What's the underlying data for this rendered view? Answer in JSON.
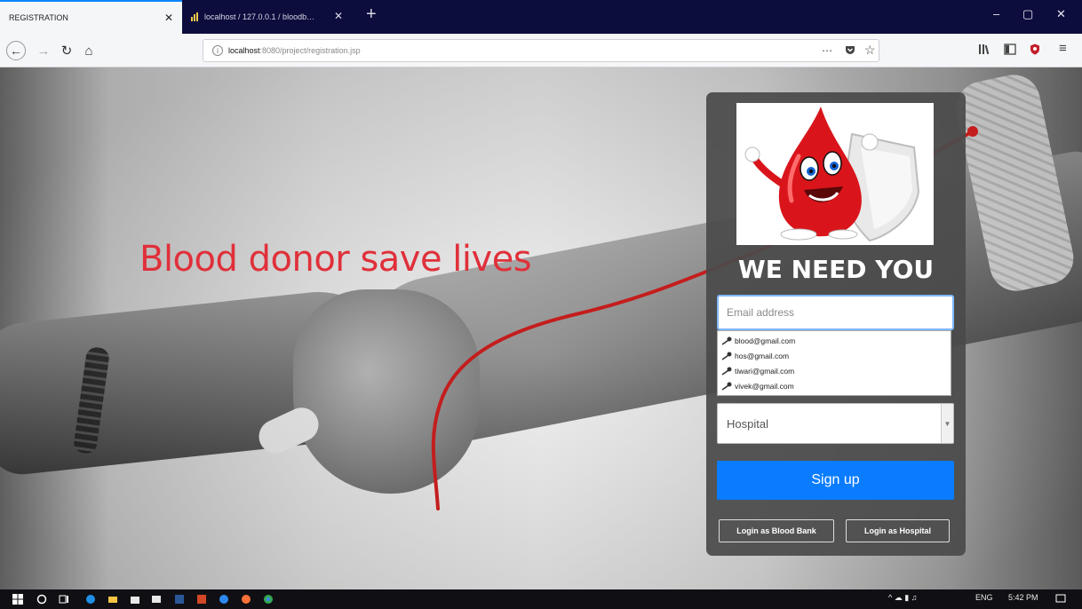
{
  "browser": {
    "tabs": [
      {
        "title": "REGISTRATION",
        "active": true
      },
      {
        "title": "localhost / 127.0.0.1 / bloodb…",
        "active": false
      }
    ],
    "new_tab_symbol": "+",
    "window_controls": {
      "minimize": "–",
      "maximize": "▢",
      "close": "✕"
    },
    "url": {
      "host": "localhost",
      "rest": ":8080/project/registration.jsp"
    },
    "url_actions": {
      "more": "⋯"
    },
    "icons": [
      "back-icon",
      "forward-icon",
      "reload-icon",
      "home-icon",
      "info-icon",
      "pocket-icon",
      "bookmark-star-icon",
      "library-icon",
      "sidebar-icon",
      "shield-addon-icon",
      "menu-icon"
    ]
  },
  "page": {
    "tagline": "Blood donor save lives",
    "colors": {
      "tagline": "#e0303a",
      "primary_button": "#0a7cff",
      "panel": "#4a4a4a"
    }
  },
  "form": {
    "title": "WE NEED YOU",
    "email_placeholder": "Email address",
    "autocomplete": [
      "blood@gmail.com",
      "hos@gmail.com",
      "tiwari@gmail.com",
      "vivek@gmail.com"
    ],
    "type_select": "Hospital",
    "signup_label": "Sign up",
    "login_bank_label": "Login as Blood Bank",
    "login_hospital_label": "Login as Hospital"
  },
  "taskbar": {
    "tray": {
      "language": "ENG",
      "time": "5:42 PM"
    }
  }
}
